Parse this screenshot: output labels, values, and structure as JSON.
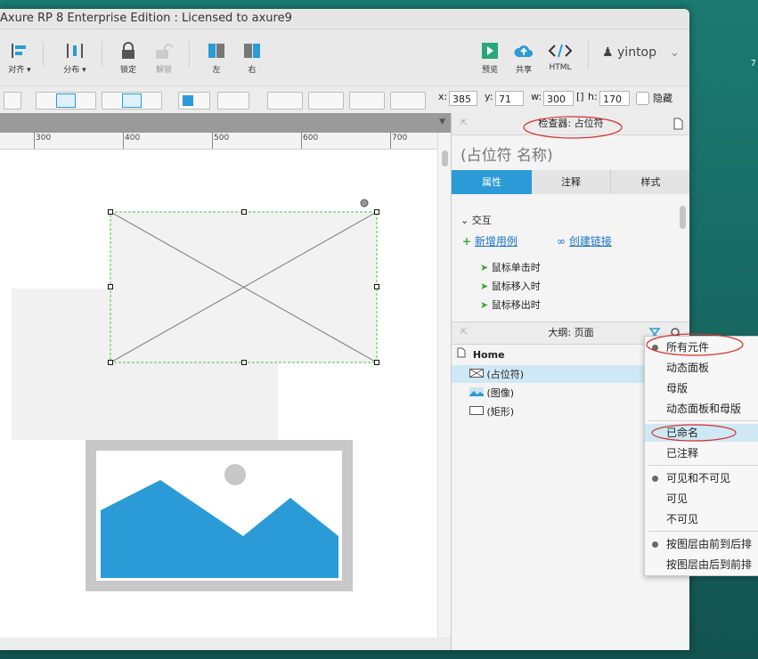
{
  "app": {
    "title": "Axure RP 8 Enterprise Edition : Licensed to axure9"
  },
  "background": {
    "text": "7"
  },
  "toolbar": {
    "align": "对齐 ▾",
    "distribute": "分布 ▾",
    "lock": "锁定",
    "unlock": "解锁",
    "left": "左",
    "right": "右",
    "preview": "预览",
    "share": "共享",
    "html": "HTML",
    "user": "yintop"
  },
  "format": {
    "x_label": "x:",
    "x_value": "385",
    "y_label": "y:",
    "y_value": "71",
    "w_label": "w:",
    "w_value": "300",
    "h_label": "h:",
    "h_value": "170",
    "hide_label": "隐藏"
  },
  "ruler": {
    "labels": [
      "300",
      "400",
      "500",
      "600",
      "700"
    ]
  },
  "inspector": {
    "header": "检查器: 占位符",
    "name_placeholder": "(占位符 名称)",
    "tabs": [
      "属性",
      "注释",
      "样式"
    ],
    "section": "交互",
    "add_case": "新增用例",
    "create_link": "创建链接",
    "events": [
      "鼠标单击时",
      "鼠标移入时",
      "鼠标移出时"
    ]
  },
  "outline": {
    "header": "大纲: 页面",
    "page": "Home",
    "items": [
      "(占位符)",
      "(图像)",
      "(矩形)"
    ]
  },
  "filter_menu": {
    "items": [
      "所有元件",
      "动态面板",
      "母版",
      "动态面板和母版",
      "已命名",
      "已注释",
      "可见和不可见",
      "可见",
      "不可见",
      "按图层由前到后排",
      "按图层由后到前排"
    ]
  },
  "colors": {
    "accent": "#2a9bd6",
    "selection_green": "#3ec93e",
    "annotation_red": "#d9302c",
    "image_blue": "#2a9bd6"
  }
}
